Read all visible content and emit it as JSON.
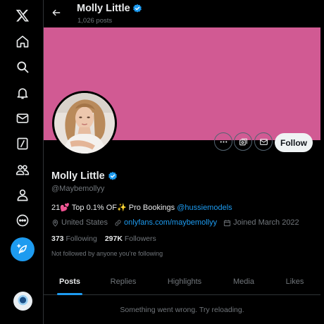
{
  "colors": {
    "accent": "#1d9bf0",
    "banner": "#d15a93",
    "background": "#000000",
    "muted": "#71767b"
  },
  "nav": {
    "items": [
      {
        "name": "x-logo-icon"
      },
      {
        "name": "home-icon"
      },
      {
        "name": "explore-icon"
      },
      {
        "name": "notifications-icon"
      },
      {
        "name": "messages-icon"
      },
      {
        "name": "grok-icon"
      },
      {
        "name": "communities-icon"
      },
      {
        "name": "profile-icon"
      },
      {
        "name": "more-icon"
      }
    ],
    "post_button_icon": "feather-plus-icon",
    "account_avatar_icon": "account-avatar-icon"
  },
  "header": {
    "back_icon": "back-arrow-icon",
    "name": "Molly Little",
    "post_count": "1,026 posts"
  },
  "profile": {
    "display_name": "Molly Little",
    "handle": "@Maybemollyy",
    "bio_text": "21💕 Top 0.1% OF✨ Pro Bookings ",
    "bio_mention": "@hussiemodels",
    "location": "United States",
    "website": "onlyfans.com/maybemollyy",
    "joined": "Joined March 2022",
    "following_count": "373",
    "following_label": "Following",
    "followers_count": "297K",
    "followers_label": "Followers",
    "followers_you_know": "Not followed by anyone you’re following"
  },
  "actions": {
    "more_icon": "more-dots-icon",
    "subscribe_icon": "subscribe-icon",
    "message_icon": "message-icon",
    "follow_label": "Follow"
  },
  "tabs": [
    {
      "label": "Posts",
      "active": true
    },
    {
      "label": "Replies",
      "active": false
    },
    {
      "label": "Highlights",
      "active": false
    },
    {
      "label": "Media",
      "active": false
    },
    {
      "label": "Likes",
      "active": false
    }
  ],
  "feed": {
    "error_message": "Something went wrong. Try reloading."
  }
}
